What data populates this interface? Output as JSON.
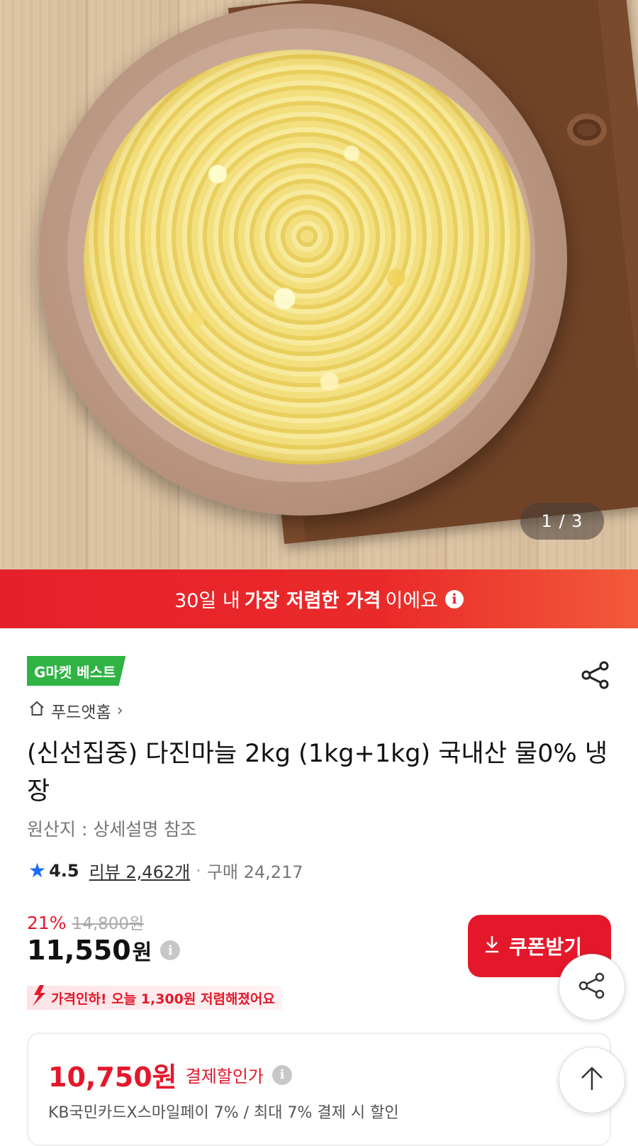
{
  "gallery": {
    "counter": "1 / 3"
  },
  "banner": {
    "prefix": "30일 내 ",
    "emphasis": "가장 저렴한 가격",
    "suffix": "이에요"
  },
  "badge": "G마켓 베스트",
  "store": {
    "name": "푸드앳홈"
  },
  "product": {
    "title": "(신선집중) 다진마늘 2kg (1kg+1kg) 국내산 물0% 냉장",
    "origin": "원산지 : 상세설명 참조"
  },
  "rating": {
    "score": "4.5",
    "review": "리뷰 2,462개",
    "separator": "·",
    "purchases": "구매 24,217"
  },
  "pricing": {
    "discount": "21%",
    "original": "14,800원",
    "price": "11,550",
    "currency": "원",
    "drop_text": "가격인하! 오늘 1,300원 저렴해졌어요"
  },
  "coupon": {
    "label": "쿠폰받기"
  },
  "payment": {
    "price": "10,750원",
    "label": "결제할인가",
    "description": "KB국민카드X스마일페이 7% / 최대 7% 결제 시 할인"
  },
  "colors": {
    "brand_red": "#e4182a",
    "badge_green": "#2fb344",
    "rating_blue": "#1b6ef3"
  },
  "icons": {
    "share": "share-icon",
    "scroll_top": "arrow-up-icon",
    "home": "home-icon",
    "info": "info-icon",
    "star": "star-icon",
    "download": "download-arrow-icon"
  }
}
